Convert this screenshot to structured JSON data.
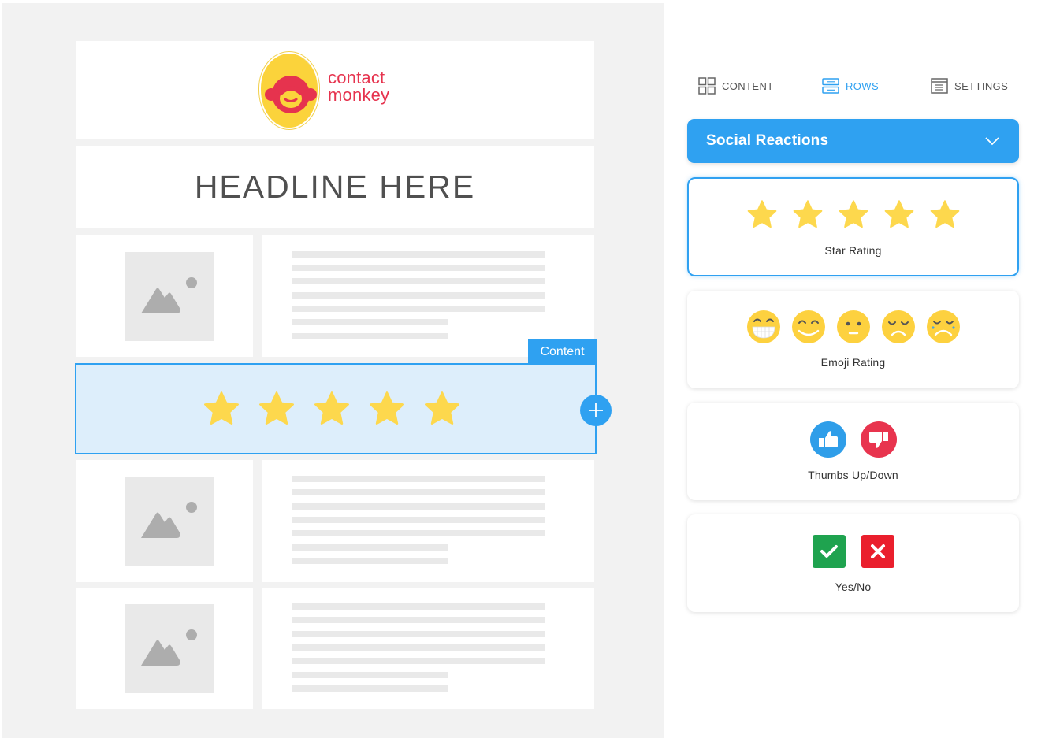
{
  "brand": {
    "logo_line1": "contact",
    "logo_line2": "monkey",
    "primary_color": "#2fa1f1",
    "logo_color": "#e6334e",
    "badge_color": "#fbd33b"
  },
  "email_preview": {
    "headline": "HEADLINE HERE",
    "selected_row": {
      "tag_label": "Content",
      "star_count": 5,
      "add_icon": "plus-icon"
    },
    "article_rows": [
      {
        "image_icon": "image-placeholder-icon",
        "text_lines": [
          "long",
          "long",
          "long",
          "long",
          "long",
          "short",
          "short"
        ]
      },
      {
        "image_icon": "image-placeholder-icon",
        "text_lines": [
          "long",
          "long",
          "long",
          "long",
          "long",
          "short",
          "short"
        ]
      },
      {
        "image_icon": "image-placeholder-icon",
        "text_lines": [
          "long",
          "long",
          "long",
          "long",
          "long",
          "short",
          "short"
        ]
      }
    ]
  },
  "panel": {
    "tabs": [
      {
        "label": "CONTENT",
        "icon": "grid-icon",
        "active": false
      },
      {
        "label": "ROWS",
        "icon": "rows-icon",
        "active": true
      },
      {
        "label": "SETTINGS",
        "icon": "settings-panel-icon",
        "active": false
      }
    ],
    "dropdown": {
      "selected": "Social Reactions",
      "icon": "chevron-down-icon"
    },
    "blocks": [
      {
        "label": "Star Rating",
        "icons": [
          "star-icon",
          "star-icon",
          "star-icon",
          "star-icon",
          "star-icon"
        ],
        "selected": true
      },
      {
        "label": "Emoji Rating",
        "icons": [
          "grinning-face-icon",
          "smiling-face-icon",
          "neutral-face-icon",
          "sad-face-icon",
          "crying-face-icon"
        ],
        "selected": false
      },
      {
        "label": "Thumbs Up/Down",
        "icons": [
          "thumbs-up-icon",
          "thumbs-down-icon"
        ],
        "selected": false
      },
      {
        "label": "Yes/No",
        "icons": [
          "check-icon",
          "x-icon"
        ],
        "selected": false
      }
    ]
  }
}
